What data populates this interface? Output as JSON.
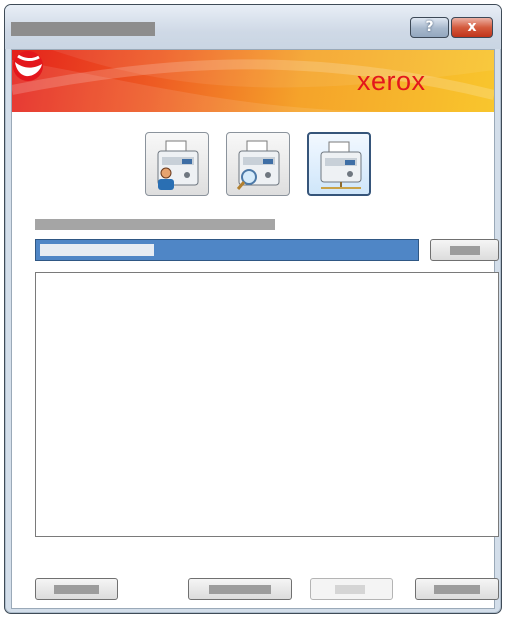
{
  "window": {
    "title": "",
    "help_label": "?",
    "close_label": "x"
  },
  "banner": {
    "brand_text": "xerox",
    "logo_icon": "xerox-sphere-icon",
    "colors": {
      "from": "#e4211c",
      "to": "#f8c62d",
      "brand": "#e3171c"
    }
  },
  "functions": [
    {
      "icon": "printer-user-icon",
      "selected": false
    },
    {
      "icon": "printer-search-icon",
      "selected": false
    },
    {
      "icon": "printer-network-icon",
      "selected": true
    }
  ],
  "panel": {
    "section_label": "",
    "combo_value": "",
    "combo_button_label": "",
    "list_items": []
  },
  "footer": {
    "buttons": [
      {
        "label": "",
        "enabled": true
      },
      {
        "label": "",
        "enabled": true
      },
      {
        "label": "",
        "enabled": false
      },
      {
        "label": "",
        "enabled": true
      }
    ]
  }
}
